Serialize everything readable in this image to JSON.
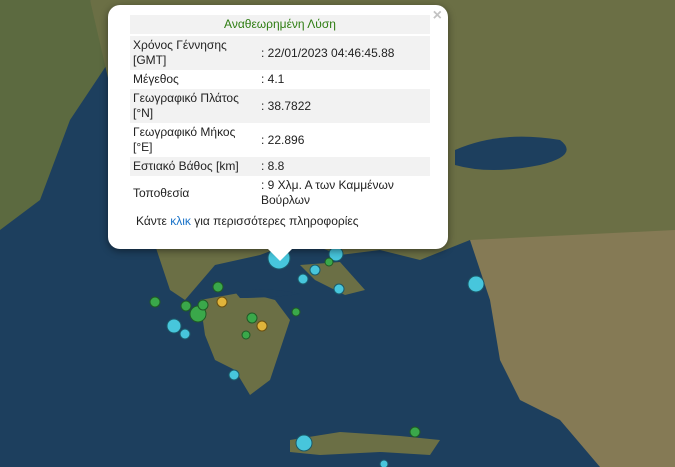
{
  "popup": {
    "title": "Αναθεωρημένη Λύση",
    "close_icon": "×",
    "rows": [
      {
        "label": "Χρόνος Γέννησης [GMT]",
        "value": ": 22/01/2023 04:46:45.88"
      },
      {
        "label": "Μέγεθος",
        "value": ": 4.1"
      },
      {
        "label": "Γεωγραφικό Πλάτος [°N]",
        "value": ": 38.7822"
      },
      {
        "label": "Γεωγραφικό Μήκος [°E]",
        "value": ": 22.896"
      },
      {
        "label": "Εστιακό Βάθος [km]",
        "value": ": 8.8"
      },
      {
        "label": "Τοποθεσία",
        "value": ": 9 Χλμ. Α των Καμμένων Βούρλων"
      }
    ],
    "footer_pre": "Κάντε ",
    "footer_link": "κλικ",
    "footer_post": " για περισσότερες πληροφορίες"
  },
  "map": {
    "colors": {
      "sea": "#1d3f5e",
      "land": "#5b6b3f",
      "highland": "#7a7552",
      "green_marker": "#3aa84a",
      "cyan_marker": "#47c6dc",
      "yellow_marker": "#e0b43a"
    }
  }
}
